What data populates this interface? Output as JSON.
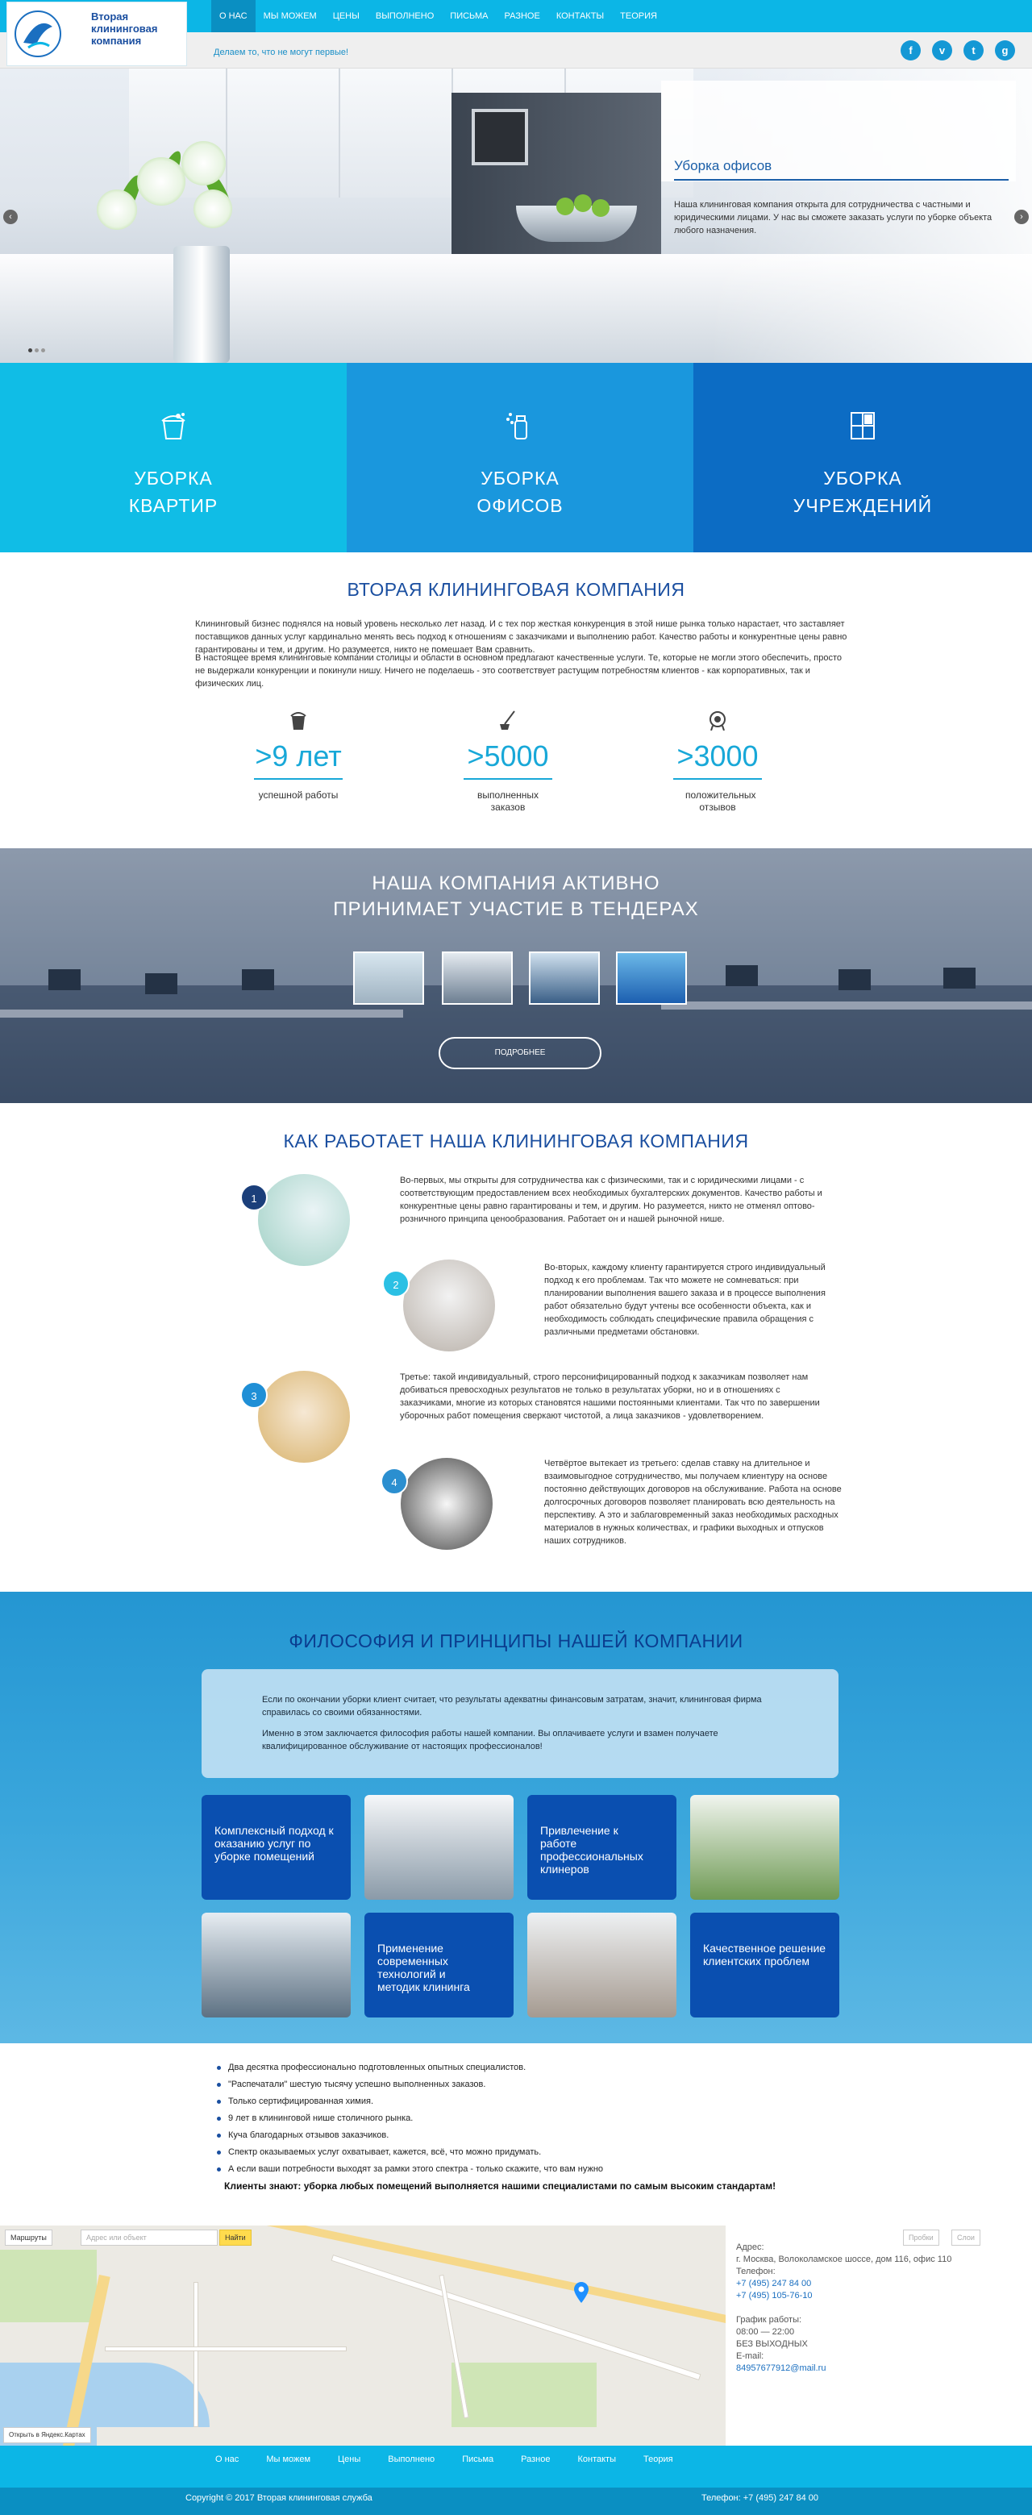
{
  "header": {
    "logo_text": "Вторая клининговая компания",
    "menu": [
      "О НАС",
      "МЫ МОЖЕМ",
      "ЦЕНЫ",
      "ВЫПОЛНЕНО",
      "ПИСЬМА",
      "РАЗНОЕ",
      "КОНТАКТЫ",
      "ТЕОРИЯ"
    ],
    "slogan": "Делаем то, что не могут первые!",
    "social": [
      "f",
      "v",
      "t",
      "g"
    ]
  },
  "slider": {
    "title": "Уборка офисов",
    "text": "Наша клининговая компания открыта для сотрудничества с частными и юридическими лицами. У нас вы сможете заказать услуги по уборке объекта любого назначения.",
    "prev": "‹",
    "next": "›"
  },
  "services": [
    {
      "line1": "УБОРКА",
      "line2": "КВАРТИР",
      "icon": "bucket-icon"
    },
    {
      "line1": "УБОРКА",
      "line2": "ОФИСОВ",
      "icon": "spray-icon"
    },
    {
      "line1": "УБОРКА",
      "line2": "УЧРЕЖДЕНИЙ",
      "icon": "window-icon"
    }
  ],
  "about": {
    "title": "ВТОРАЯ КЛИНИНГОВАЯ КОМПАНИЯ",
    "p1": "Клининговый бизнес поднялся на новый уровень несколько лет назад. И с тех пор жесткая конкуренция в этой нише рынка только нарастает, что заставляет поставщиков данных услуг кардинально менять весь подход к отношениям с заказчиками и выполнению работ. Качество работы и конкурентные цены равно гарантированы и тем, и другим. Но разумеется, никто не помешает Вам сравнить.",
    "p2": "В настоящее время клининговые компании столицы и области в основном предлагают качественные услуги. Те, которые не могли этого обеспечить, просто не выдержали конкуренции и покинули нишу. Ничего не поделаешь - это соответствует растущим потребностям клиентов - как корпоративных, так и физических лиц.",
    "stats": [
      {
        "num": ">9 лет",
        "label": "успешной работы",
        "icon": "bucket-icon"
      },
      {
        "num": ">5000",
        "label": "выполненных заказов",
        "icon": "mop-icon"
      },
      {
        "num": ">3000",
        "label": "положительных отзывов",
        "icon": "star-badge-icon"
      }
    ]
  },
  "tenders": {
    "title_line1": "НАША КОМПАНИЯ АКТИВНО",
    "title_line2": "ПРИНИМАЕТ УЧАСТИЕ В ТЕНДЕРАХ",
    "button": "ПОДРОБНЕЕ"
  },
  "how": {
    "title": "КАК РАБОТАЕТ НАША КЛИНИНГОВАЯ КОМПАНИЯ",
    "steps": [
      {
        "num": "1",
        "text": "Во-первых, мы открыты для сотрудничества как с физическими, так и с юридическими лицами - с соответствующим предоставлением всех необходимых бухгалтерских документов. Качество работы и конкурентные цены равно гарантированы и тем, и другим. Но разумеется, никто не отменял оптово-розничного принципа ценообразования. Работает он и нашей рыночной нише."
      },
      {
        "num": "2",
        "text": "Во-вторых, каждому клиенту гарантируется строго индивидуальный подход к его проблемам. Так что можете не сомневаться: при планировании выполнения вашего заказа и в процессе выполнения работ обязательно будут учтены все особенности объекта, как и необходимость соблюдать специфические правила обращения с различными предметами обстановки."
      },
      {
        "num": "3",
        "text": "Третье: такой индивидуальный, строго персонифицированный подход к заказчикам позволяет нам добиваться превосходных результатов не только в результатах уборки, но и в отношениях с заказчиками, многие из которых становятся нашими постоянными клиентами. Так что по завершении уборочных работ помещения сверкают чистотой, а лица заказчиков - удовлетворением."
      },
      {
        "num": "4",
        "text": "Четвёртое вытекает из третьего: сделав ставку на длительное и взаимовыгодное сотрудничество, мы получаем клиентуру на основе постоянно действующих договоров на обслуживание. Работа на основе долгосрочных договоров позволяет планировать всю деятельность на перспективу. А это и заблаговременный заказ необходимых расходных материалов в нужных количествах, и графики выходных и отпусков наших сотрудников."
      }
    ]
  },
  "philosophy": {
    "title": "ФИЛОСОФИЯ И ПРИНЦИПЫ НАШЕЙ КОМПАНИИ",
    "p1": "Если по окончании уборки клиент считает, что результаты адекватны финансовым затратам, значит, клининговая фирма справилась со своими обязанностями.",
    "p2": "Именно в этом заключается философия работы нашей компании. Вы оплачиваете услуги и взамен получаете квалифицированное обслуживание от настоящих профессионалов!",
    "cards": [
      "Комплексный подход к оказанию услуг по уборке помещений",
      "Привлечение к работе профессиональных клинеров",
      "Применение современных технологий и методик клининга",
      "Качественное решение клиентских проблем"
    ]
  },
  "list": {
    "items": [
      "Два десятка профессионально подготовленных опытных специалистов.",
      "\"Распечатали\" шестую тысячу успешно выполненных заказов.",
      "Только сертифицированная химия.",
      "9 лет в клининговой нише столичного рынка.",
      "Куча благодарных отзывов заказчиков.",
      "Спектр оказываемых услуг охватывает, кажется, всё, что можно придумать.",
      "А если ваши потребности выходят за рамки этого спектра - только скажите, что вам нужно"
    ],
    "bold": "Клиенты знают: уборка любых помещений выполняется нашими специалистами по самым высоким стандартам!"
  },
  "map": {
    "routes": "Маршруты",
    "address_ph": "Адрес или объект",
    "find": "Найти",
    "open": "Открыть в Яндекс.Картах",
    "traffic": "Пробки",
    "layers": "Слои"
  },
  "contacts": {
    "address_label": "Адрес:",
    "address": "г. Москва, Волоколамское шоссе, дом 116, офис 110",
    "phone_label": "Телефон:",
    "phone1": "+7 (495) 247 84 00",
    "phone2": "+7 (495) 105-76-10",
    "hours_label": "График работы:",
    "hours": "08:00 — 22:00",
    "days": "БЕЗ ВЫХОДНЫХ",
    "email_label": "E-mail:",
    "email": "84957677912@mail.ru"
  },
  "footer": {
    "menu": [
      "О нас",
      "Мы можем",
      "Цены",
      "Выполнено",
      "Письма",
      "Разное",
      "Контакты",
      "Теория"
    ],
    "copyright": "Copyright © 2017 Вторая клининговая служба",
    "phone": "Телефон: +7 (495) 247 84 00"
  },
  "colors": {
    "accent": "#0cb6e6",
    "dark_blue": "#1b4fa0",
    "service1": "#10bde6",
    "service2": "#1a97dd",
    "service3": "#0c6cc4"
  }
}
